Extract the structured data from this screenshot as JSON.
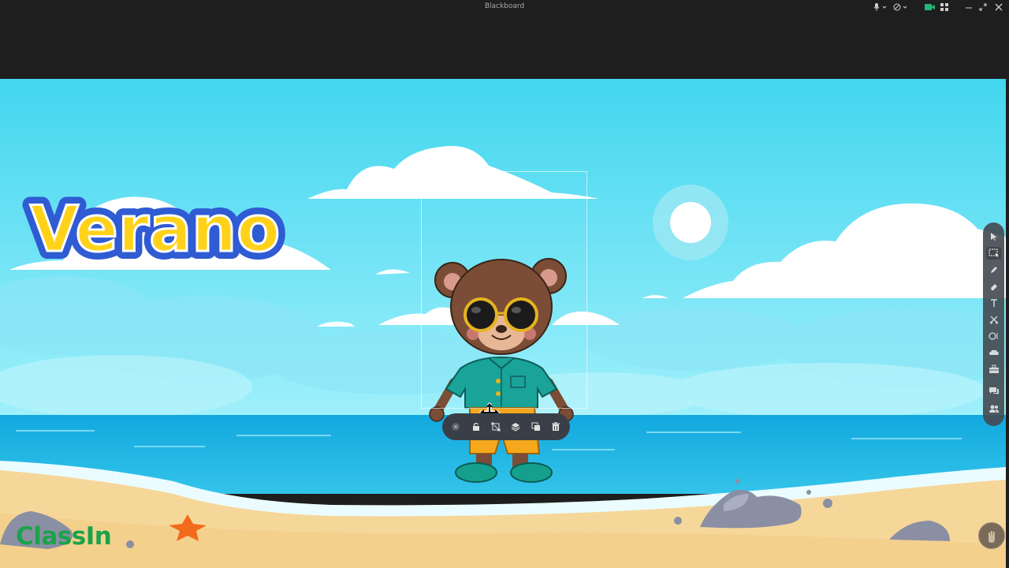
{
  "window": {
    "title": "Blackboard"
  },
  "scene": {
    "heading": "Verano",
    "brand": "ClassIn",
    "colors": {
      "sky": "#4fd8ee",
      "sea": "#1fb3e0",
      "sand": "#f6d79a",
      "title_fill": "#ffd21a",
      "title_outline": "#2f5bd3"
    }
  },
  "titlebar_controls": [
    {
      "name": "microphone-icon"
    },
    {
      "name": "speaker-icon"
    },
    {
      "name": "camera-icon"
    },
    {
      "name": "grid-layout-icon"
    },
    {
      "name": "minimize-icon"
    },
    {
      "name": "restore-icon"
    },
    {
      "name": "close-icon"
    }
  ],
  "toolbar": {
    "tools": [
      {
        "name": "select-tool",
        "icon": "cursor-icon"
      },
      {
        "name": "area-select-tool",
        "icon": "marquee-select-icon",
        "active": true
      },
      {
        "name": "pen-tool",
        "icon": "pen-icon"
      },
      {
        "name": "eraser-tool",
        "icon": "eraser-icon"
      },
      {
        "name": "text-tool",
        "icon": "text-icon"
      },
      {
        "name": "scissors-tool",
        "icon": "scissors-icon"
      },
      {
        "name": "shape-tool",
        "icon": "shape-icon"
      },
      {
        "name": "cloud-tool",
        "icon": "cloud-icon"
      },
      {
        "name": "toolbox-tool",
        "icon": "toolbox-icon"
      },
      {
        "name": "chat-tool",
        "icon": "chat-icon"
      },
      {
        "name": "users-tool",
        "icon": "users-icon"
      }
    ]
  },
  "context_bar": {
    "buttons": [
      {
        "name": "close-selection",
        "icon": "close-icon"
      },
      {
        "name": "lock",
        "icon": "lock-icon"
      },
      {
        "name": "transform",
        "icon": "transform-icon"
      },
      {
        "name": "layers",
        "icon": "layers-icon"
      },
      {
        "name": "duplicate",
        "icon": "duplicate-icon"
      },
      {
        "name": "delete",
        "icon": "trash-icon"
      }
    ]
  }
}
